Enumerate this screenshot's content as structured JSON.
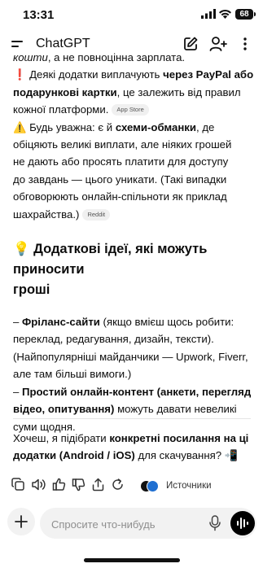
{
  "status_bar": {
    "time": "13:31",
    "battery": "68"
  },
  "header": {
    "title": "ChatGPT",
    "icons": [
      "menu-icon",
      "new-chat-icon",
      "add-user-icon",
      "more-icon"
    ]
  },
  "message": {
    "line1_italic": "кошти",
    "line1_rest": ", а не повноцінна зарплата.",
    "p1_emoji": "❗",
    "p1_a": " Деякі додатки виплачують ",
    "p1_b": "через PayPal або",
    "p1_c": "подарункові картки",
    "p1_d": ", це залежить від правил",
    "p1_e": "кожної платформи.",
    "chip1": "App Store",
    "p2_emoji": "⚠️",
    "p2_a": " Будь уважна: є й ",
    "p2_b": "схеми-обманки",
    "p2_c": ", де",
    "p2_l2": "обіцяють великі виплати, але ніяких грошей",
    "p2_l3": "не дають або просять платити для доступу",
    "p2_l4": "до завдань — цього уникати. (Такі випадки",
    "p2_l5": "обговорюють онлайн-спільноти як приклад",
    "p2_l6": "шахрайства.)",
    "chip2": "Reddit",
    "heading_emoji": "💡",
    "heading_l1": " Додаткові ідеї, які можуть приносити",
    "heading_l2": "гроші",
    "b1_a": "– ",
    "b1_b": "Фріланс-сайти",
    "b1_c": " (якщо вмієш щось робити:",
    "b1_l2": "переклад, редагування, дизайн, тексти).",
    "b1_l3": "(Найпопулярніші майданчики — Upwork, Fiverr,",
    "b1_l4": "але там більші вимоги.)",
    "b2_a": "– ",
    "b2_b": "Простий онлайн-контент (анкети, перегляд",
    "b2_l2b": "відео, опитування)",
    "b2_l2c": " можуть давати невеликі",
    "b2_l3": "суми щодня."
  },
  "followup": {
    "a": "Хочеш, я підібрати ",
    "b": "конкретні посилання на ці",
    "c": "додатки (Android / iOS)",
    "d": " для скачування? ",
    "emoji": "📲"
  },
  "actions": {
    "icons": [
      "copy-icon",
      "read-aloud-icon",
      "thumbs-up-icon",
      "thumbs-down-icon",
      "share-icon",
      "regenerate-icon"
    ],
    "sources_label": "Источники"
  },
  "composer": {
    "placeholder": "Спросите что-нибудь"
  }
}
